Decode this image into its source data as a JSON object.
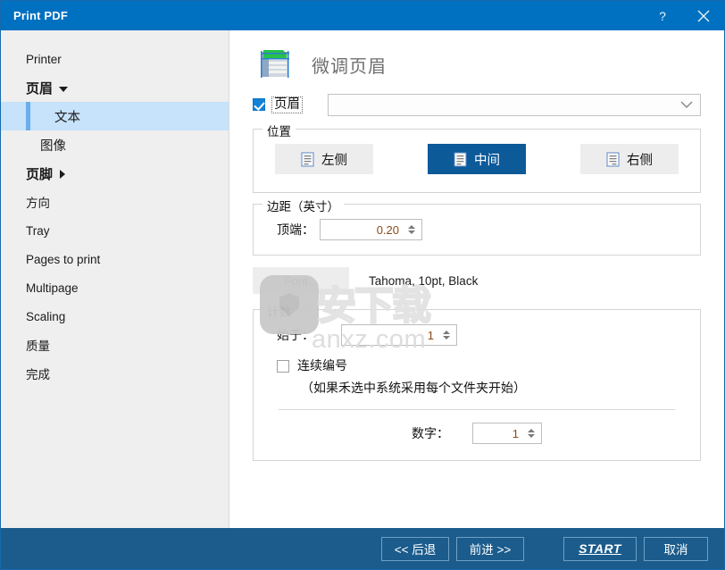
{
  "window": {
    "title": "Print PDF",
    "help_icon": "question-mark-icon",
    "close_icon": "close-icon"
  },
  "sidebar": {
    "items": [
      {
        "label": "Printer",
        "type": "item",
        "state": "normal"
      },
      {
        "label": "页眉",
        "type": "group-expanded",
        "state": "normal"
      },
      {
        "label": "文本",
        "type": "sub",
        "state": "active"
      },
      {
        "label": "图像",
        "type": "sub",
        "state": "normal"
      },
      {
        "label": "页脚",
        "type": "group-collapsed",
        "state": "normal"
      },
      {
        "label": "方向",
        "type": "item",
        "state": "normal"
      },
      {
        "label": "Tray",
        "type": "item",
        "state": "normal"
      },
      {
        "label": "Pages to print",
        "type": "item",
        "state": "normal"
      },
      {
        "label": "Multipage",
        "type": "item",
        "state": "normal"
      },
      {
        "label": "Scaling",
        "type": "item",
        "state": "normal"
      },
      {
        "label": "质量",
        "type": "item",
        "state": "normal"
      },
      {
        "label": "完成",
        "type": "item",
        "state": "normal"
      }
    ]
  },
  "main": {
    "page_icon": "spreadsheet-document-icon",
    "page_title": "微调页眉",
    "header_toggle": {
      "label": "页眉",
      "checked": true
    },
    "header_combo": {
      "value": "",
      "placeholder": ""
    },
    "position": {
      "legend": "位置",
      "options": [
        {
          "label": "左侧",
          "selected": false
        },
        {
          "label": "中间",
          "selected": true
        },
        {
          "label": "右侧",
          "selected": false
        }
      ]
    },
    "margin": {
      "legend": "边距（英寸）",
      "top_label": "顶端：",
      "top_value": "0.20"
    },
    "font": {
      "button_label": "Font...",
      "description": "Tahoma, 10pt, Black"
    },
    "counting": {
      "legend": "计数",
      "start_label": "始于：",
      "start_value": "1",
      "continuous_label": "连续编号",
      "continuous_checked": false,
      "continuous_hint": "（如果禾选中系统采用每个文件夹开始）",
      "digits_label": "数字：",
      "digits_value": "1"
    }
  },
  "watermark": {
    "site": "anxz.com",
    "mark": "安下载"
  },
  "footer": {
    "back": "<< 后退",
    "next": "前进 >>",
    "start": "START",
    "cancel": "取消"
  },
  "colors": {
    "title_bar": "#0070c0",
    "footer_bar": "#1b5c8d",
    "accent_selected": "#0d5a99",
    "sidebar_active": "#c7e2fb",
    "sidebar_accent": "#6aaeec",
    "spin_value": "#8a4a18"
  }
}
